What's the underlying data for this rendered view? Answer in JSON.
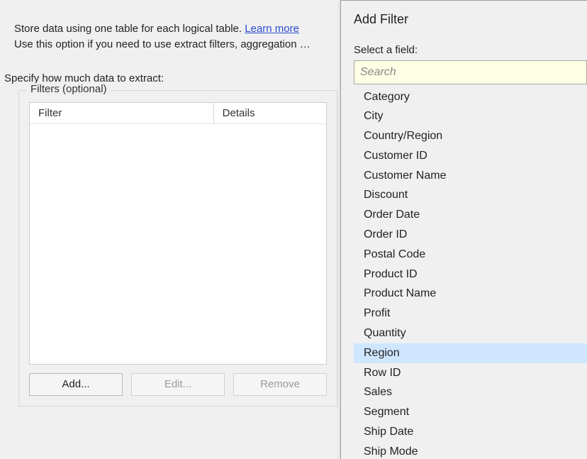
{
  "description": {
    "line1_a": "Store data using one table for each logical table. ",
    "line1_link": "Learn more",
    "line2": "Use this option if you need to use extract filters, aggregation …"
  },
  "specify_label": "Specify how much data to extract:",
  "filters_group": {
    "legend": "Filters (optional)",
    "col_filter": "Filter",
    "col_details": "Details"
  },
  "buttons": {
    "add": "Add...",
    "edit": "Edit...",
    "remove": "Remove"
  },
  "popup": {
    "title": "Add Filter",
    "select_label": "Select a field:",
    "search_placeholder": "Search",
    "selected_index": 13,
    "fields": [
      "Category",
      "City",
      "Country/Region",
      "Customer ID",
      "Customer Name",
      "Discount",
      "Order Date",
      "Order ID",
      "Postal Code",
      "Product ID",
      "Product Name",
      "Profit",
      "Quantity",
      "Region",
      "Row ID",
      "Sales",
      "Segment",
      "Ship Date",
      "Ship Mode"
    ]
  }
}
